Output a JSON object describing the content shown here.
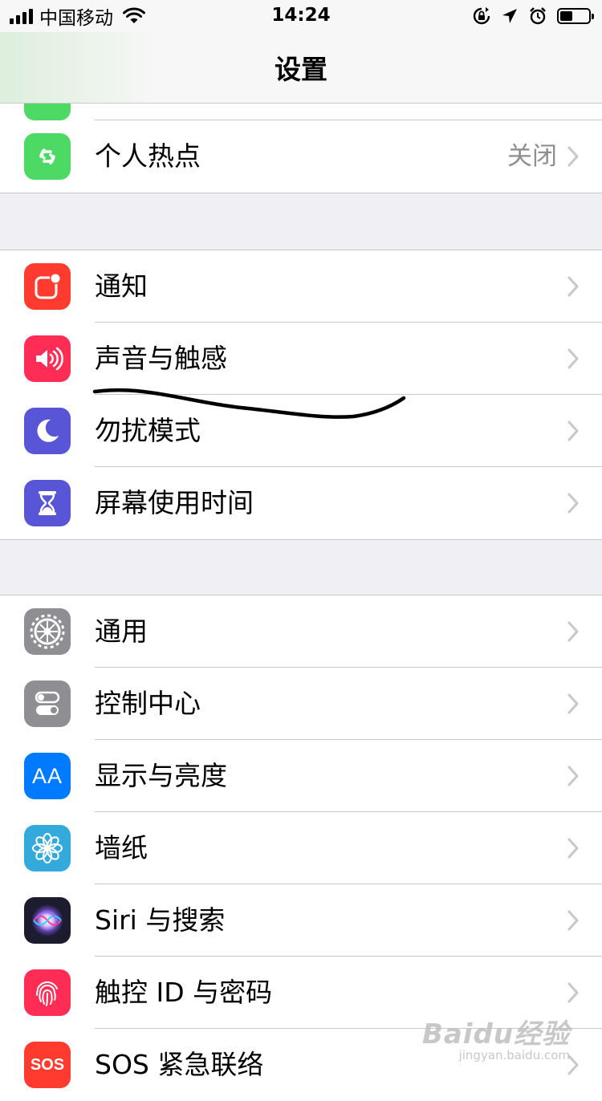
{
  "status_bar": {
    "carrier": "中国移动",
    "time": "14:24",
    "battery_level": 0.45
  },
  "nav": {
    "title": "设置"
  },
  "groups": [
    {
      "rows": [
        {
          "label": "个人热点",
          "value": "关闭",
          "icon": "hotspot-icon",
          "icon_color": "#4cd964"
        }
      ]
    },
    {
      "rows": [
        {
          "label": "通知",
          "icon": "notification-icon",
          "icon_color": "#ff3b30"
        },
        {
          "label": "声音与触感",
          "icon": "sound-icon",
          "icon_color": "#ff2d55"
        },
        {
          "label": "勿扰模式",
          "icon": "moon-icon",
          "icon_color": "#5856d6"
        },
        {
          "label": "屏幕使用时间",
          "icon": "hourglass-icon",
          "icon_color": "#5856d6"
        }
      ]
    },
    {
      "rows": [
        {
          "label": "通用",
          "icon": "gear-icon",
          "icon_color": "#8e8e93"
        },
        {
          "label": "控制中心",
          "icon": "toggle-icon",
          "icon_color": "#8e8e93"
        },
        {
          "label": "显示与亮度",
          "icon": "text-size-icon",
          "icon_color": "#007aff",
          "icon_text": "AA"
        },
        {
          "label": "墙纸",
          "icon": "flower-icon",
          "icon_color": "#34aadc"
        },
        {
          "label": "Siri 与搜索",
          "icon": "siri-icon",
          "icon_color": "#1c1c2e"
        },
        {
          "label": "触控 ID 与密码",
          "icon": "fingerprint-icon",
          "icon_color": "#ff2d55"
        },
        {
          "label": "SOS 紧急联络",
          "icon": "sos-icon",
          "icon_color": "#ff3b30",
          "icon_text": "SOS"
        }
      ]
    }
  ],
  "watermark": {
    "main": "Baidu经验",
    "sub": "jingyan.baidu.com"
  }
}
